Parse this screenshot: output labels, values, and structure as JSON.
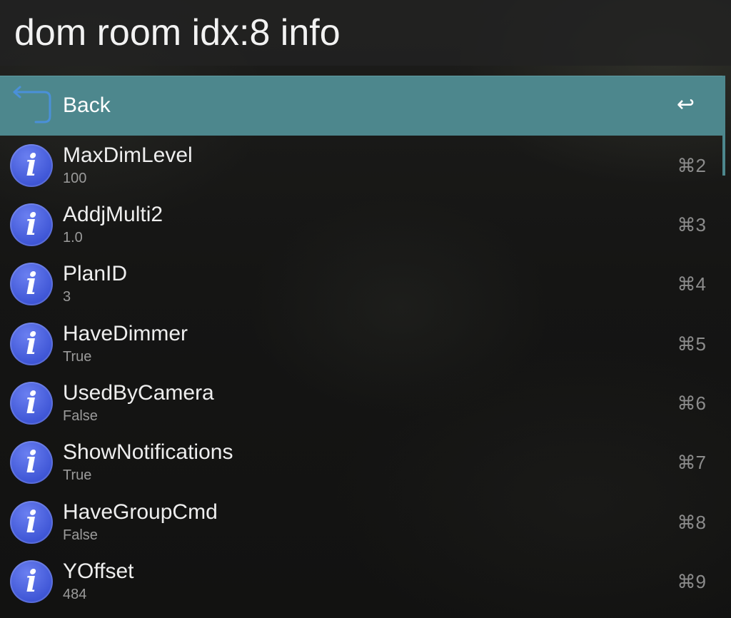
{
  "search": {
    "query": "dom room idx:8 info"
  },
  "results": [
    {
      "title": "Back",
      "subtitle": "",
      "shortcut": "↩",
      "icon": "back-arrow-icon",
      "selected": true
    },
    {
      "title": "MaxDimLevel",
      "subtitle": "100",
      "shortcut": "⌘2",
      "icon": "info-icon"
    },
    {
      "title": "AddjMulti2",
      "subtitle": "1.0",
      "shortcut": "⌘3",
      "icon": "info-icon"
    },
    {
      "title": "PlanID",
      "subtitle": "3",
      "shortcut": "⌘4",
      "icon": "info-icon"
    },
    {
      "title": "HaveDimmer",
      "subtitle": "True",
      "shortcut": "⌘5",
      "icon": "info-icon"
    },
    {
      "title": "UsedByCamera",
      "subtitle": "False",
      "shortcut": "⌘6",
      "icon": "info-icon"
    },
    {
      "title": "ShowNotifications",
      "subtitle": "True",
      "shortcut": "⌘7",
      "icon": "info-icon"
    },
    {
      "title": "HaveGroupCmd",
      "subtitle": "False",
      "shortcut": "⌘8",
      "icon": "info-icon"
    },
    {
      "title": "YOffset",
      "subtitle": "484",
      "shortcut": "⌘9",
      "icon": "info-icon"
    }
  ],
  "icons": {
    "info_glyph": "i"
  },
  "colors": {
    "selection": "#4d878d",
    "info_icon": "#4a5fe0",
    "back_icon_stroke": "#4a90d9"
  }
}
